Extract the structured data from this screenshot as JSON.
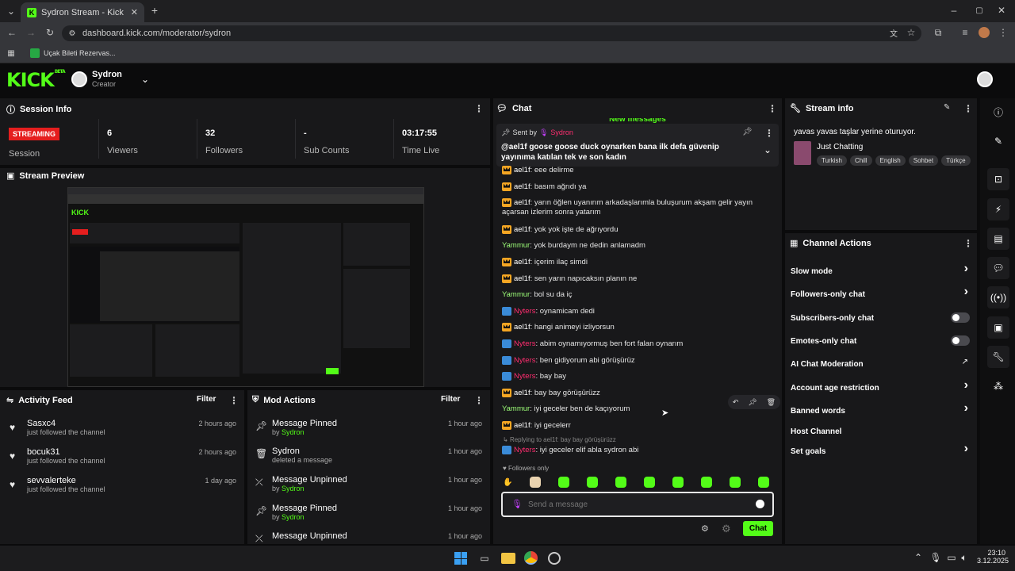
{
  "browser": {
    "tab_title": "Sydron Stream - Kick Dashboard",
    "url": "dashboard.kick.com/moderator/sydron",
    "bookmark": "Uçak Bileti Rezervas..."
  },
  "header": {
    "logo": "KICK",
    "logo_beta": "BETA",
    "channel_name": "Sydron",
    "channel_role": "Creator"
  },
  "session": {
    "title": "Session Info",
    "status": "STREAMING",
    "status_label": "Session",
    "stats": [
      {
        "value": "6",
        "label": "Viewers"
      },
      {
        "value": "32",
        "label": "Followers"
      },
      {
        "value": "-",
        "label": "Sub Counts"
      },
      {
        "value": "03:17:55",
        "label": "Time Live"
      }
    ]
  },
  "preview": {
    "title": "Stream Preview"
  },
  "activity": {
    "title": "Activity Feed",
    "filter": "Filter",
    "items": [
      {
        "name": "Sasxc4",
        "sub": "just followed the channel",
        "time": "2 hours ago"
      },
      {
        "name": "bocuk31",
        "sub": "just followed the channel",
        "time": "2 hours ago"
      },
      {
        "name": "sevvalerteke",
        "sub": "just followed the channel",
        "time": "1 day ago"
      }
    ]
  },
  "mod": {
    "title": "Mod Actions",
    "filter": "Filter",
    "items": [
      {
        "title": "Message Pinned",
        "by": "by",
        "user": "Sydron",
        "time": "1 hour ago"
      },
      {
        "title": "Sydron",
        "by": "deleted a message",
        "user": "",
        "time": "1 hour ago"
      },
      {
        "title": "Message Unpinned",
        "by": "by",
        "user": "Sydron",
        "time": "1 hour ago"
      },
      {
        "title": "Message Pinned",
        "by": "by",
        "user": "Sydron",
        "time": "1 hour ago"
      },
      {
        "title": "Message Unpinned",
        "by": "",
        "user": "",
        "time": "1 hour ago"
      }
    ]
  },
  "chat": {
    "title": "Chat",
    "new_messages": "New messages",
    "pinned": {
      "sent_by": "Sent by",
      "user": "Sydron",
      "text": "@ael1f goose goose duck oynarken bana ilk defa güvenip yayınıma katılan tek ve son kadın"
    },
    "messages": [
      {
        "user": "ael1f",
        "type": "ael",
        "text": "eee delirme"
      },
      {
        "user": "ael1f",
        "type": "ael",
        "text": "basım ağrıdı ya"
      },
      {
        "user": "ael1f",
        "type": "ael",
        "text": "yarın öğlen uyanırım arkadaşlarımla buluşurum akşam gelir yayın",
        "cont": "açarsan izlerim sonra yatarım"
      },
      {
        "user": "ael1f",
        "type": "ael",
        "text": "yok yok işte de ağrıyordu"
      },
      {
        "user": "Yammur",
        "type": "yam",
        "text": "yok burdaym ne dedin anlamadm"
      },
      {
        "user": "ael1f",
        "type": "ael",
        "text": "içerim ilaç simdi"
      },
      {
        "user": "ael1f",
        "type": "ael",
        "text": "sen yarın napıcaksın planın ne"
      },
      {
        "user": "Yammur",
        "type": "yam",
        "text": "bol su da iç"
      },
      {
        "user": "Nyters",
        "type": "nyt",
        "text": "oynamicam dedi"
      },
      {
        "user": "ael1f",
        "type": "ael",
        "text": "hangi animeyi izliyorsun"
      },
      {
        "user": "Nyters",
        "type": "nyt",
        "text": "abim oynamıyormuş ben fort falan oynarım"
      },
      {
        "user": "Nyters",
        "type": "nyt",
        "text": "ben gidiyorum abi görüşürüz"
      },
      {
        "user": "Nyters",
        "type": "nyt",
        "text": "bay bay"
      },
      {
        "user": "ael1f",
        "type": "ael",
        "text": "bay bay görüşürüzz"
      },
      {
        "user": "Yammur",
        "type": "yam",
        "text": "iyi geceler ben de kaçıyorum"
      },
      {
        "user": "ael1f",
        "type": "ael",
        "text": "iyi gecelerr"
      }
    ],
    "reply_to": "Replying to ael1f: bay bay görüşürüzz",
    "reply_msg": {
      "user": "Nyters",
      "text": "iyi geceler elif abla sydron abi"
    },
    "followers_only": "Followers only",
    "placeholder": "Send a message",
    "send": "Chat"
  },
  "stream_info": {
    "title": "Stream info",
    "stream_title": "yavas yavas taşlar yerine oturuyor.",
    "category": "Just Chatting",
    "tags": [
      "Turkish",
      "Chill",
      "English",
      "Sohbet",
      "Türkçe"
    ]
  },
  "channel_actions": {
    "title": "Channel Actions",
    "items": [
      {
        "label": "Slow mode",
        "ctrl": "chevron"
      },
      {
        "label": "Followers-only chat",
        "ctrl": "chevron"
      },
      {
        "label": "Subscribers-only chat",
        "ctrl": "toggle"
      },
      {
        "label": "Emotes-only chat",
        "ctrl": "toggle"
      },
      {
        "label": "AI Chat Moderation",
        "ctrl": "external"
      },
      {
        "label": "Account age restriction",
        "ctrl": "chevron"
      },
      {
        "label": "Banned words",
        "ctrl": "chevron"
      },
      {
        "label": "Host Channel",
        "ctrl": "none"
      },
      {
        "label": "Set goals",
        "ctrl": "chevron"
      }
    ]
  },
  "taskbar": {
    "time": "23:10",
    "date": "3.12.2025"
  },
  "colors": {
    "accent": "#53fc18",
    "live": "#e51e1e",
    "panel": "#18181a"
  }
}
